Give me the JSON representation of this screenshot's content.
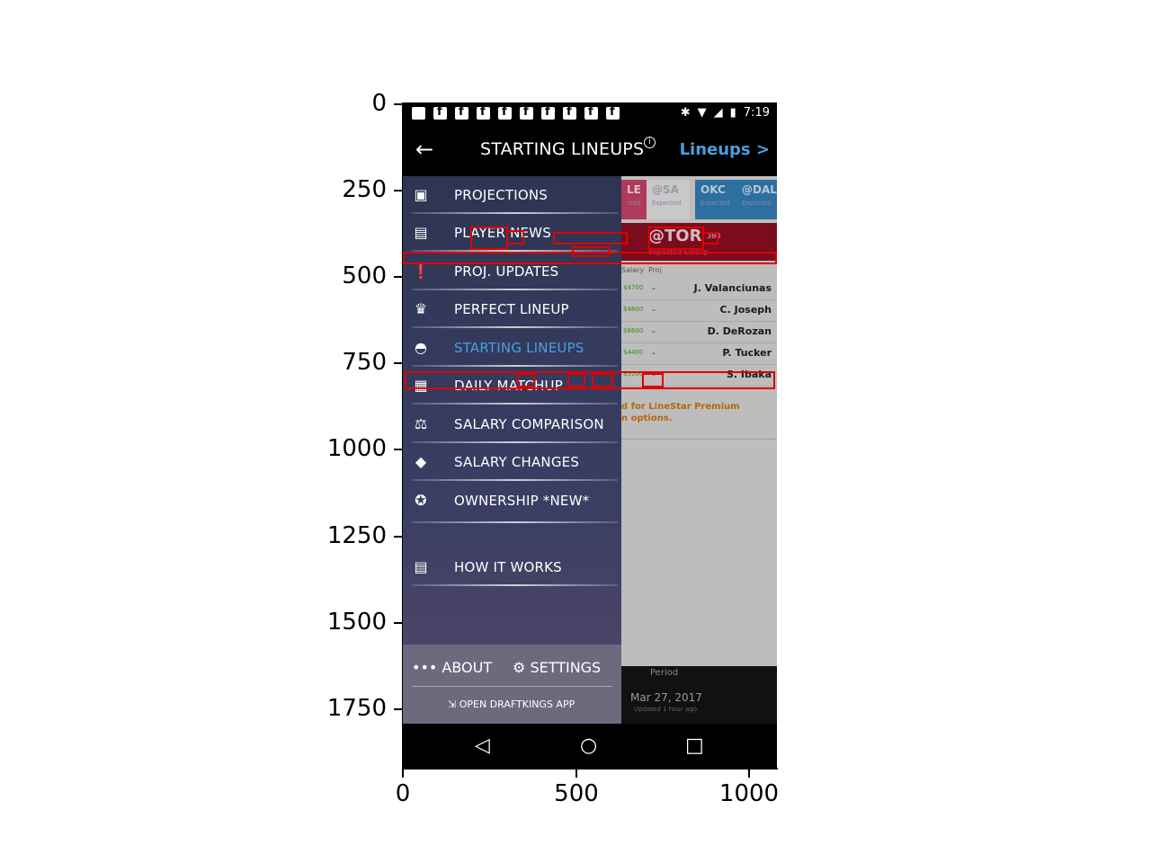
{
  "axes": {
    "yticks": [
      "0",
      "250",
      "500",
      "750",
      "1000",
      "1250",
      "1500",
      "1750"
    ],
    "xticks": [
      "0",
      "500",
      "1000"
    ]
  },
  "statusbar": {
    "time": "7:19"
  },
  "appbar": {
    "title": "STARTING LINEUPS",
    "lineups_link": "Lineups >"
  },
  "drawer": {
    "items": [
      {
        "label": "PROJECTIONS",
        "icon": "chart-icon"
      },
      {
        "label": "PLAYER NEWS",
        "icon": "newspaper-icon"
      },
      {
        "label": "PROJ. UPDATES",
        "icon": "alert-icon"
      },
      {
        "label": "PERFECT LINEUP",
        "icon": "trophy-icon"
      },
      {
        "label": "STARTING LINEUPS",
        "icon": "gauge-icon",
        "active": true
      },
      {
        "label": "DAILY MATCHUP",
        "icon": "clipboard-icon"
      },
      {
        "label": "SALARY COMPARISON",
        "icon": "scale-icon"
      },
      {
        "label": "SALARY CHANGES",
        "icon": "dollar-diamond-icon"
      },
      {
        "label": "OWNERSHIP *NEW*",
        "icon": "star-badge-icon"
      },
      {
        "label": "HOW IT WORKS",
        "icon": "document-icon"
      }
    ],
    "about_label": "ABOUT",
    "settings_label": "SETTINGS",
    "open_app_label": "OPEN DRAFTKINGS APP"
  },
  "content": {
    "tabs": [
      {
        "team": "LE",
        "sub": "cted"
      },
      {
        "team": "@SA",
        "sub": "Expected"
      },
      {
        "team": "OKC",
        "sub": "Expected"
      },
      {
        "team": "@DAL",
        "sub": "Expected"
      }
    ],
    "team_header": "@TOR",
    "team_header_sub": "Expected Lineup",
    "team_header_num": "380",
    "col_salary": "Salary",
    "col_proj": "Proj",
    "players": [
      {
        "salary": "$4700",
        "proj": "-",
        "name": "J. Valanciunas"
      },
      {
        "salary": "$4800",
        "proj": "-",
        "name": "C. Joseph"
      },
      {
        "salary": "$8600",
        "proj": "-",
        "name": "D. DeRozan"
      },
      {
        "salary": "$4400",
        "proj": "-",
        "name": "P. Tucker"
      },
      {
        "salary": "$5100",
        "proj": "-",
        "name": "S. Ibaka"
      }
    ],
    "premium_note_1": "d for LineStar Premium",
    "premium_note_2": "n options.",
    "period_label": "Period",
    "period_date": "Mar 27, 2017",
    "period_updated": "Updated 1 hour ago"
  },
  "colors": {
    "accent_blue": "#4a9fe0",
    "annotation_red": "#e00000",
    "team_red": "#7a0c1e",
    "drawer_bg": "#343a5c"
  }
}
